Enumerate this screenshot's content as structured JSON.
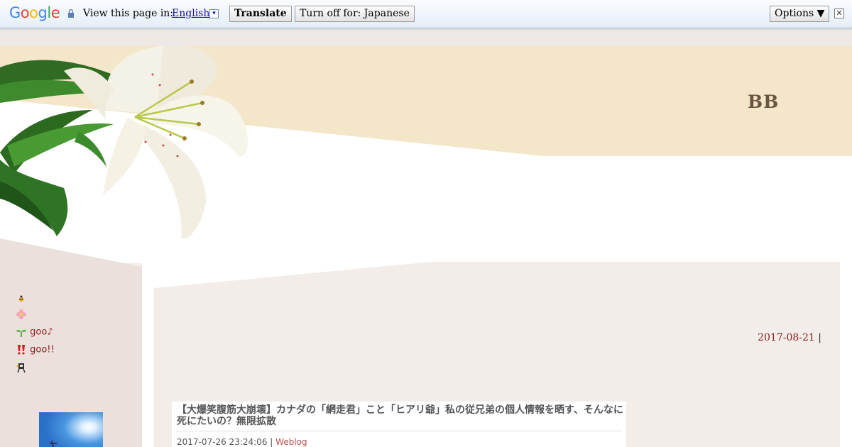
{
  "translate_bar": {
    "logo_letters": [
      "G",
      "o",
      "o",
      "g",
      "l",
      "e"
    ],
    "view_label": "View this page in:",
    "language": "English",
    "dropdown_glyph": "▾",
    "translate_label": "Translate",
    "turn_off_label": "Turn off for: Japanese",
    "options_label": "Options ▼",
    "close_glyph": "✕"
  },
  "header": {
    "blog_title": "BB",
    "band_color": "#f3e6c9"
  },
  "sidebar": {
    "items": [
      {
        "icon": "bee-icon",
        "label": ""
      },
      {
        "icon": "flower-icon",
        "label": ""
      },
      {
        "icon": "sprout-icon",
        "label": "goo♪"
      },
      {
        "icon": "exclamation-icon",
        "label": "goo!!"
      },
      {
        "icon": "bird-icon",
        "label": ""
      }
    ]
  },
  "main": {
    "date": "2017-08-21",
    "date_separator": "|",
    "entry": {
      "title": "【大爆笑腹筋大崩壊】カナダの「網走君」こと「ヒアリ爺」私の従兄弟の個人情報を晒す、そんなに死にたいの？無限拡散",
      "timestamp": "2017-07-26 23:24:06",
      "meta_separator": "|",
      "category": "Weblog"
    }
  }
}
